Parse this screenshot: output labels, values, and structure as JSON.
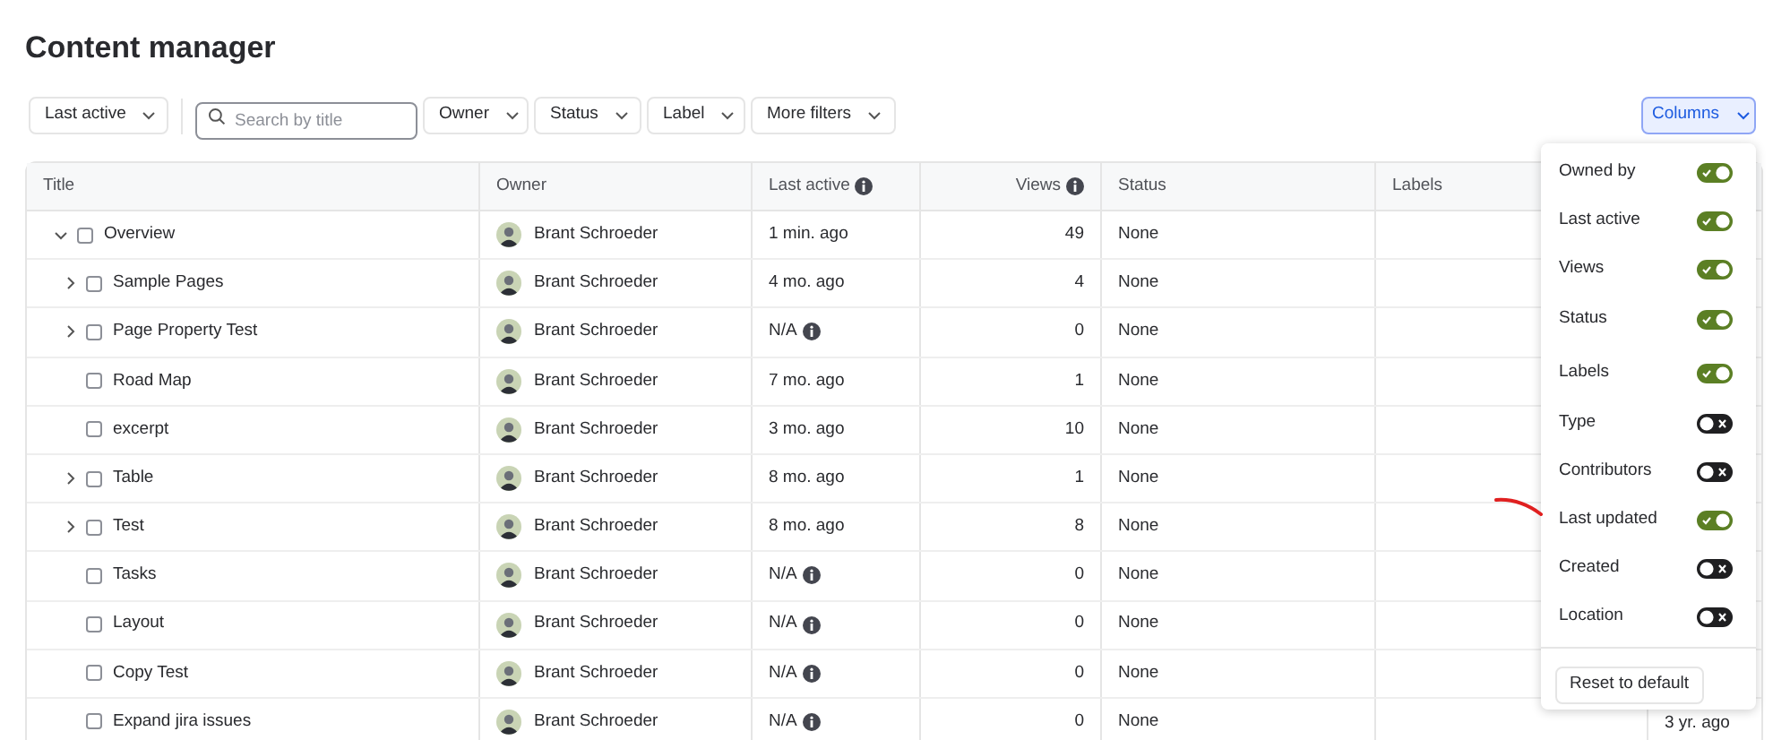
{
  "title": "Content manager",
  "toolbar": {
    "sort": "Last active",
    "search": {
      "placeholder": "Search by title"
    },
    "filters": [
      "Owner",
      "Status",
      "Label",
      "More filters"
    ],
    "columns_button": "Columns"
  },
  "table": {
    "columns": [
      "Title",
      "Owner",
      "Last active",
      "Views",
      "Status",
      "Labels"
    ],
    "info_columns": [
      false,
      false,
      true,
      true,
      false,
      false
    ],
    "rows": [
      {
        "title": "Overview",
        "expanded": true,
        "checked": false,
        "owner": "Brant Schroeder",
        "last_active": "1 min. ago",
        "info": false,
        "views": "49",
        "status": "None",
        "children": [
          {
            "title": "Sample Pages",
            "expanded": false,
            "checked": false,
            "owner": "Brant Schroeder",
            "last_active": "4 mo. ago",
            "info": false,
            "views": "4",
            "status": "None"
          },
          {
            "title": "Page Property Test",
            "expanded": false,
            "checked": false,
            "owner": "Brant Schroeder",
            "last_active": "N/A",
            "info": true,
            "views": "0",
            "status": "None"
          },
          {
            "title": "Road Map",
            "checked": false,
            "owner": "Brant Schroeder",
            "last_active": "7 mo. ago",
            "info": false,
            "views": "1",
            "status": "None"
          },
          {
            "title": "excerpt",
            "checked": false,
            "owner": "Brant Schroeder",
            "last_active": "3 mo. ago",
            "info": false,
            "views": "10",
            "status": "None"
          },
          {
            "title": "Table",
            "expanded": false,
            "checked": false,
            "owner": "Brant Schroeder",
            "last_active": "8 mo. ago",
            "info": false,
            "views": "1",
            "status": "None"
          },
          {
            "title": "Test",
            "expanded": false,
            "checked": false,
            "owner": "Brant Schroeder",
            "last_active": "8 mo. ago",
            "info": false,
            "views": "8",
            "status": "None"
          },
          {
            "title": "Tasks",
            "checked": false,
            "owner": "Brant Schroeder",
            "last_active": "N/A",
            "info": true,
            "views": "0",
            "status": "None"
          },
          {
            "title": "Layout",
            "checked": false,
            "owner": "Brant Schroeder",
            "last_active": "N/A",
            "info": true,
            "views": "0",
            "status": "None"
          },
          {
            "title": "Copy Test",
            "checked": false,
            "owner": "Brant Schroeder",
            "last_active": "N/A",
            "info": true,
            "views": "0",
            "status": "None"
          },
          {
            "title": "Expand jira issues",
            "checked": false,
            "owner": "Brant Schroeder",
            "last_active": "N/A",
            "info": true,
            "views": "0",
            "status": "None",
            "column_7": "3 yr. ago"
          }
        ]
      }
    ]
  },
  "columns_menu": {
    "items": [
      {
        "label": "Owned by",
        "on": true
      },
      {
        "label": "Last active",
        "on": true
      },
      {
        "label": "Views",
        "on": true
      },
      {
        "label": "Status",
        "on": true
      },
      {
        "label": "Labels",
        "on": true
      },
      {
        "label": "Type",
        "on": false
      },
      {
        "label": "Contributors",
        "on": false
      },
      {
        "label": "Last updated",
        "on": true
      },
      {
        "label": "Created",
        "on": false
      },
      {
        "label": "Location",
        "on": false
      }
    ],
    "reset_button": "Reset to default"
  }
}
